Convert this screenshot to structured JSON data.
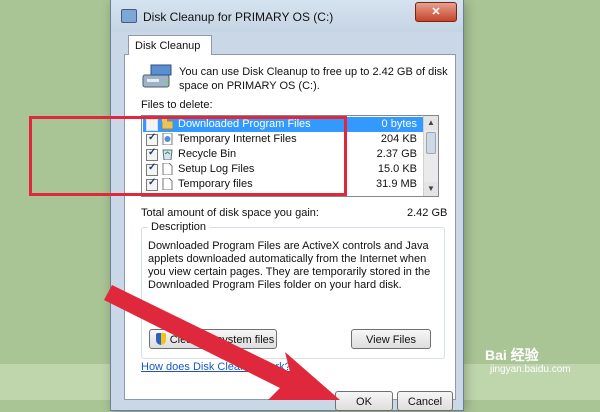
{
  "window": {
    "title": "Disk Cleanup for PRIMARY OS (C:)",
    "close_label": "✕"
  },
  "tab": {
    "label": "Disk Cleanup"
  },
  "intro": "You can use Disk Cleanup to free up to 2.42 GB of disk space on PRIMARY OS (C:).",
  "files_label": "Files to delete:",
  "files": [
    {
      "name": "Downloaded Program Files",
      "size": "0 bytes",
      "checked": false,
      "selected": true,
      "icon": "folder-icon"
    },
    {
      "name": "Temporary Internet Files",
      "size": "204 KB",
      "checked": true,
      "selected": false,
      "icon": "internet-files-icon"
    },
    {
      "name": "Recycle Bin",
      "size": "2.37 GB",
      "checked": true,
      "selected": false,
      "icon": "recycle-bin-icon"
    },
    {
      "name": "Setup Log Files",
      "size": "15.0 KB",
      "checked": true,
      "selected": false,
      "icon": "file-icon"
    },
    {
      "name": "Temporary files",
      "size": "31.9 MB",
      "checked": true,
      "selected": false,
      "icon": "file-icon"
    }
  ],
  "total": {
    "label": "Total amount of disk space you gain:",
    "value": "2.42 GB"
  },
  "description": {
    "legend": "Description",
    "text": "Downloaded Program Files are ActiveX controls and Java applets downloaded automatically from the Internet when you view certain pages. They are temporarily stored in the Downloaded Program Files folder on your hard disk."
  },
  "buttons": {
    "clean_system": "Clean up system files",
    "view_files": "View Files",
    "ok": "OK",
    "cancel": "Cancel"
  },
  "help_link": "How does Disk Cleanup work?",
  "watermark": {
    "brand": "Bai 经验",
    "url": "jingyan.baidu.com"
  },
  "colors": {
    "highlight": "#e0283c",
    "selection": "#3399ff",
    "arrow": "#e0283c",
    "background": "#a9c495"
  }
}
